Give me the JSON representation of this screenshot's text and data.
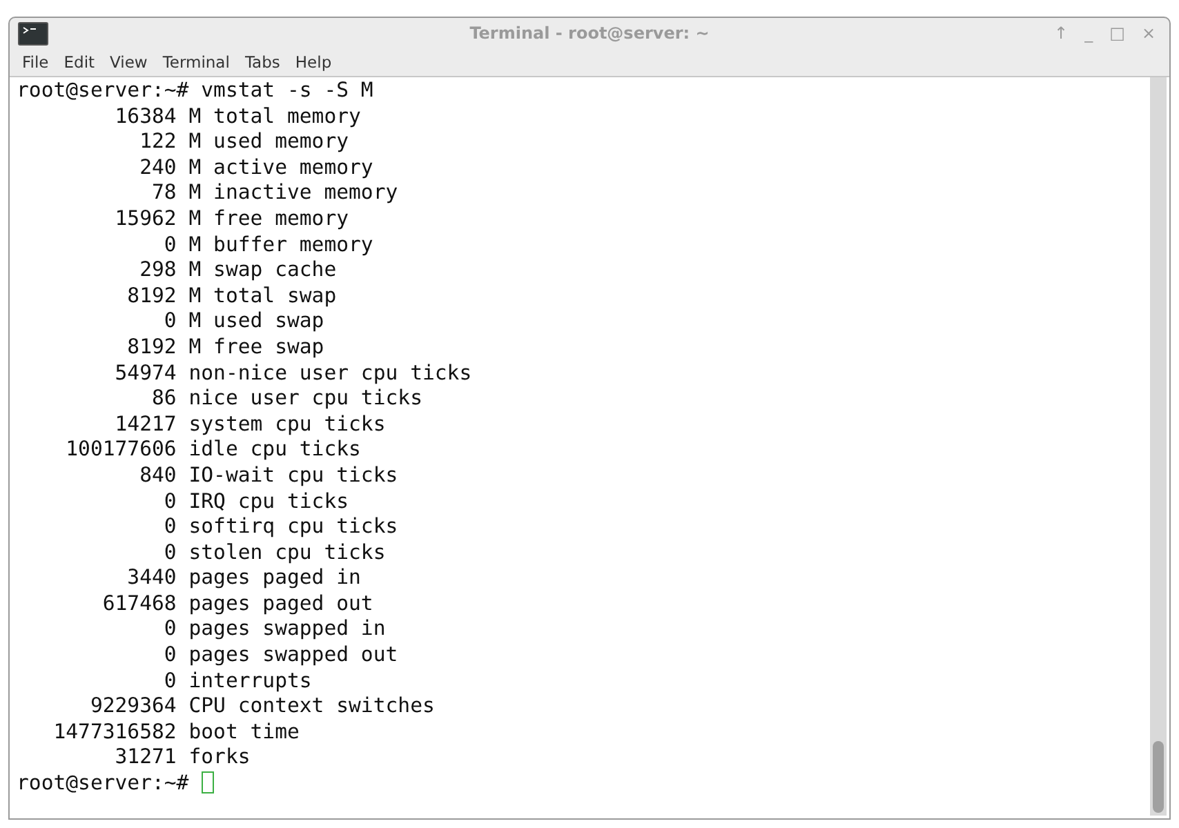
{
  "window": {
    "title": "Terminal - root@server: ~",
    "controls": [
      "↑",
      "_",
      "□",
      "×"
    ]
  },
  "menu": [
    "File",
    "Edit",
    "View",
    "Terminal",
    "Tabs",
    "Help"
  ],
  "terminal": {
    "lines": [
      "root@server:~# vmstat -s -S M",
      "        16384 M total memory",
      "          122 M used memory",
      "          240 M active memory",
      "           78 M inactive memory",
      "        15962 M free memory",
      "            0 M buffer memory",
      "          298 M swap cache",
      "         8192 M total swap",
      "            0 M used swap",
      "         8192 M free swap",
      "        54974 non-nice user cpu ticks",
      "           86 nice user cpu ticks",
      "        14217 system cpu ticks",
      "    100177606 idle cpu ticks",
      "          840 IO-wait cpu ticks",
      "            0 IRQ cpu ticks",
      "            0 softirq cpu ticks",
      "            0 stolen cpu ticks",
      "         3440 pages paged in",
      "       617468 pages paged out",
      "            0 pages swapped in",
      "            0 pages swapped out",
      "            0 interrupts",
      "      9229364 CPU context switches",
      "   1477316582 boot time",
      "        31271 forks"
    ],
    "prompt": "root@server:~# "
  }
}
